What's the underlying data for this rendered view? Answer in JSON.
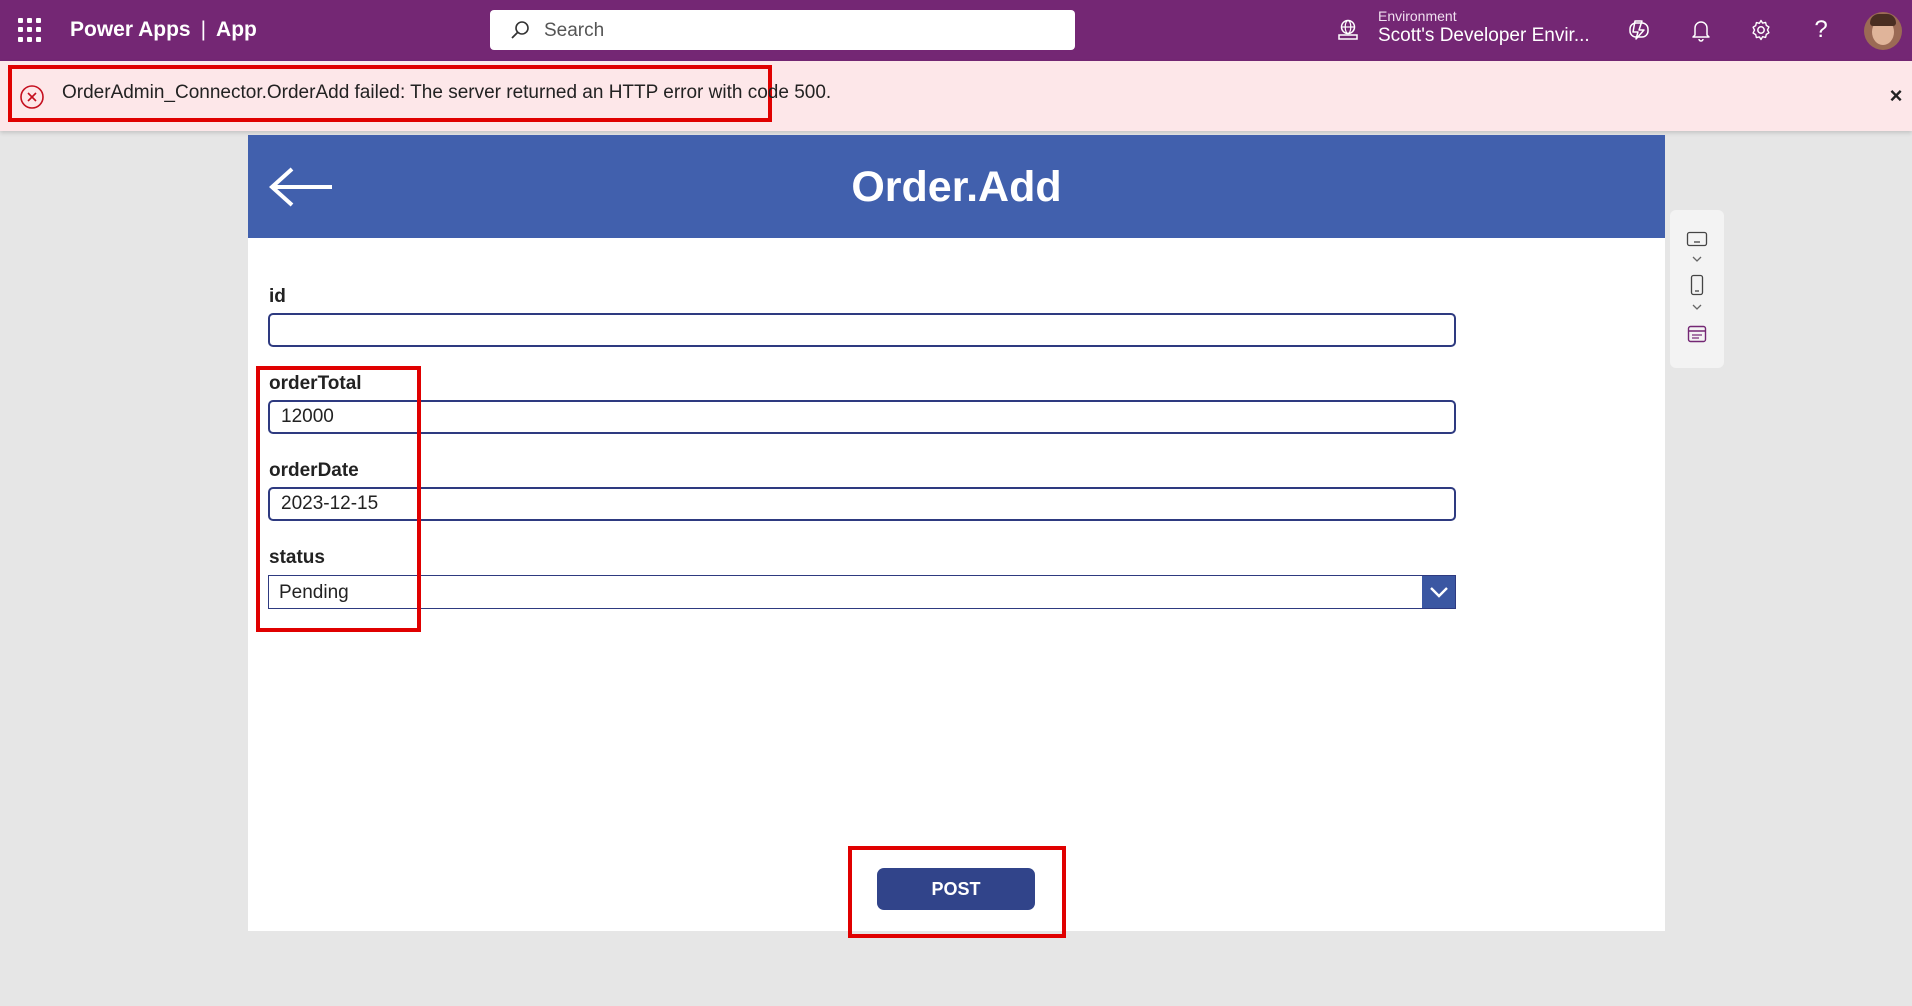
{
  "topbar": {
    "brand": "Power Apps",
    "separator": "|",
    "app": "App",
    "search_placeholder": "Search",
    "environment_label": "Environment",
    "environment_name": "Scott's Developer Envir...",
    "icons": [
      "waffle-icon",
      "search-icon",
      "environment-icon",
      "copilot-icon",
      "bell-icon",
      "gear-icon",
      "help-icon"
    ]
  },
  "error": {
    "message": "OrderAdmin_Connector.OrderAdd failed: The server returned an HTTP error with code 500.",
    "close": "×"
  },
  "screen": {
    "title": "Order.Add",
    "header_color": "#4160ad",
    "fields": {
      "id": {
        "label": "id",
        "value": ""
      },
      "orderTotal": {
        "label": "orderTotal",
        "value": "12000"
      },
      "orderDate": {
        "label": "orderDate",
        "value": "2023-12-15"
      },
      "status": {
        "label": "status",
        "value": "Pending"
      }
    },
    "post_label": "POST"
  },
  "colors": {
    "topbar": "#742774",
    "error_bg": "#fde7e9",
    "highlight": "#e00000",
    "button": "#31448a"
  }
}
